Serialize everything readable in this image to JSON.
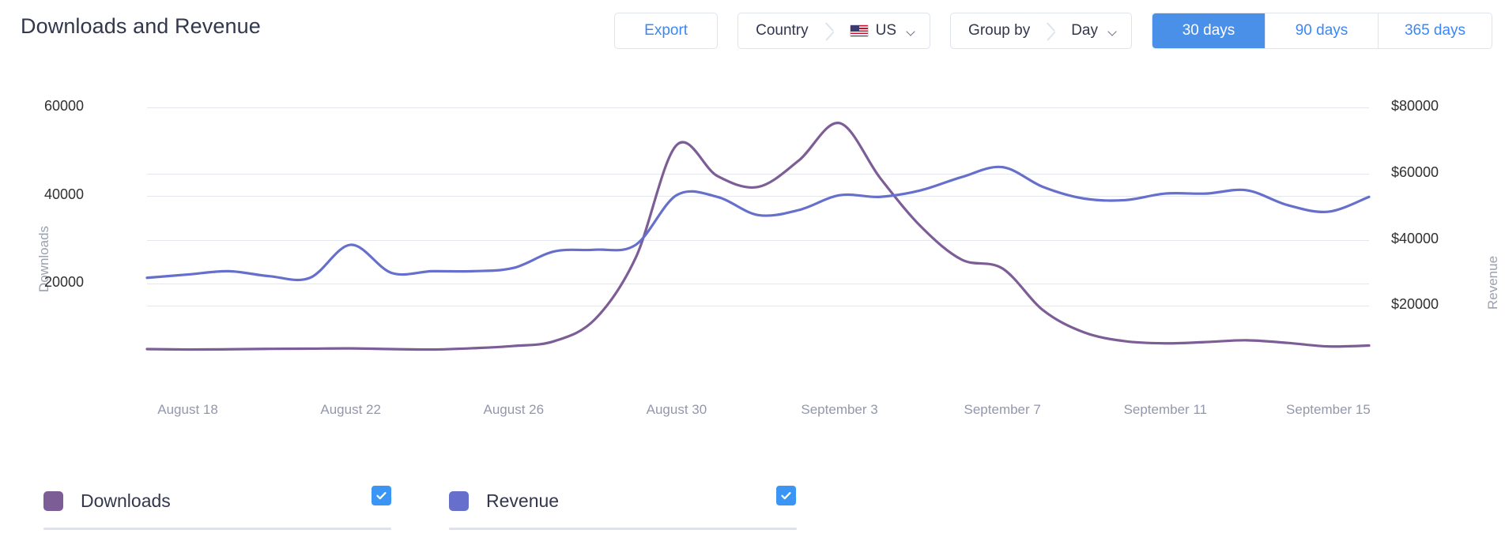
{
  "header": {
    "title": "Downloads and Revenue",
    "export_label": "Export",
    "country_label": "Country",
    "country_value": "US",
    "country_flag_icon": "us-flag-icon",
    "groupby_label": "Group by",
    "groupby_value": "Day",
    "chevron_icon": "chevron-down-icon",
    "ranges": [
      {
        "label": "30 days",
        "active": true
      },
      {
        "label": "90 days",
        "active": false
      },
      {
        "label": "365 days",
        "active": false
      }
    ]
  },
  "legend": [
    {
      "label": "Downloads",
      "color": "#7d5d96",
      "checked": true
    },
    {
      "label": "Revenue",
      "color": "#6670cc",
      "checked": true
    }
  ],
  "chart_data": {
    "type": "line",
    "title": "Downloads and Revenue",
    "xlabel": "",
    "ylabel": "Downloads",
    "y2label": "Revenue",
    "grid": true,
    "legend_position": "bottom",
    "ylim": [
      0,
      64000
    ],
    "y2lim": [
      0,
      85333
    ],
    "yticks": [
      20000,
      40000,
      60000
    ],
    "ytick_labels": [
      "20000",
      "40000",
      "60000"
    ],
    "y2ticks": [
      20000,
      40000,
      60000,
      80000
    ],
    "y2tick_labels": [
      "$20000",
      "$40000",
      "$60000",
      "$80000"
    ],
    "x": [
      "August 17",
      "August 18",
      "August 19",
      "August 20",
      "August 21",
      "August 22",
      "August 23",
      "August 24",
      "August 25",
      "August 26",
      "August 27",
      "August 28",
      "August 29",
      "August 30",
      "August 31",
      "September 1",
      "September 2",
      "September 3",
      "September 4",
      "September 5",
      "September 6",
      "September 7",
      "September 8",
      "September 9",
      "September 10",
      "September 11",
      "September 12",
      "September 13",
      "September 14",
      "September 15",
      "September 16"
    ],
    "xtick_labels": [
      "August 18",
      "August 22",
      "August 26",
      "August 30",
      "September 3",
      "September 7",
      "September 11",
      "September 15"
    ],
    "xtick_positions": [
      1,
      5,
      9,
      13,
      17,
      21,
      25,
      29
    ],
    "series": [
      {
        "name": "Downloads",
        "color": "#7d5d96",
        "axis": "left",
        "values": [
          5200,
          5100,
          5150,
          5250,
          5300,
          5350,
          5200,
          5100,
          5400,
          5900,
          7000,
          12000,
          26000,
          51500,
          44500,
          42000,
          48000,
          56500,
          44000,
          33000,
          25500,
          23500,
          14000,
          9000,
          7000,
          6500,
          6800,
          7200,
          6600,
          5800,
          6000
        ]
      },
      {
        "name": "Revenue",
        "color": "#6670cc",
        "axis": "right",
        "values": [
          28500,
          29500,
          30500,
          29000,
          28500,
          38500,
          30000,
          30500,
          30500,
          31500,
          36500,
          37000,
          38500,
          53500,
          53000,
          47500,
          49000,
          53500,
          53000,
          55000,
          59000,
          62000,
          56000,
          52500,
          52000,
          54000,
          54000,
          55000,
          50500,
          48500,
          53000
        ]
      }
    ]
  }
}
